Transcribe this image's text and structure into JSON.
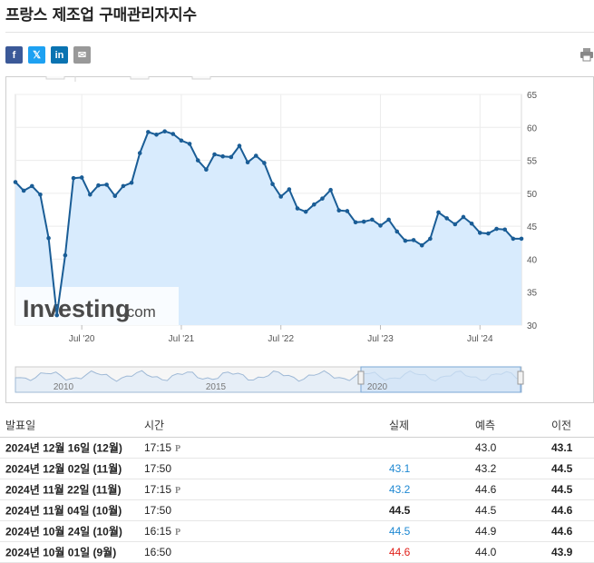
{
  "page": {
    "title": "프랑스 제조업 구매관리자지수"
  },
  "share": {
    "facebook_icon": "f",
    "twitter_icon": "𝕏",
    "linkedin_icon": "in",
    "email_icon": "✉"
  },
  "chart_data": {
    "type": "area",
    "title": "",
    "y_ticks": [
      "65",
      "60",
      "55",
      "50",
      "45",
      "40",
      "35",
      "30"
    ],
    "ylim": [
      30,
      65
    ],
    "x_tick_labels": [
      "Jul '20",
      "Jul '21",
      "Jul '22",
      "Jul '23",
      "Jul '24"
    ],
    "x_tick_dates": [
      "2020-07",
      "2021-07",
      "2022-07",
      "2023-07",
      "2024-07"
    ],
    "x_range": [
      "2019-11",
      "2024-12"
    ],
    "watermark": "Investing.com",
    "navigator_labels": [
      "2010",
      "2015",
      "2020"
    ],
    "series": [
      {
        "values": [
          [
            "2019-11",
            51.7
          ],
          [
            "2019-12",
            50.4
          ],
          [
            "2020-01",
            51.1
          ],
          [
            "2020-02",
            49.8
          ],
          [
            "2020-03",
            43.2
          ],
          [
            "2020-04",
            31.5
          ],
          [
            "2020-05",
            40.6
          ],
          [
            "2020-06",
            52.3
          ],
          [
            "2020-07",
            52.4
          ],
          [
            "2020-08",
            49.8
          ],
          [
            "2020-09",
            51.2
          ],
          [
            "2020-10",
            51.3
          ],
          [
            "2020-11",
            49.6
          ],
          [
            "2020-12",
            51.1
          ],
          [
            "2021-01",
            51.6
          ],
          [
            "2021-02",
            56.1
          ],
          [
            "2021-03",
            59.3
          ],
          [
            "2021-04",
            58.9
          ],
          [
            "2021-05",
            59.4
          ],
          [
            "2021-06",
            59.0
          ],
          [
            "2021-07",
            58.0
          ],
          [
            "2021-08",
            57.5
          ],
          [
            "2021-09",
            55.0
          ],
          [
            "2021-10",
            53.6
          ],
          [
            "2021-11",
            55.9
          ],
          [
            "2021-12",
            55.6
          ],
          [
            "2022-01",
            55.5
          ],
          [
            "2022-02",
            57.2
          ],
          [
            "2022-03",
            54.7
          ],
          [
            "2022-04",
            55.7
          ],
          [
            "2022-05",
            54.6
          ],
          [
            "2022-06",
            51.4
          ],
          [
            "2022-07",
            49.5
          ],
          [
            "2022-08",
            50.6
          ],
          [
            "2022-09",
            47.7
          ],
          [
            "2022-10",
            47.2
          ],
          [
            "2022-11",
            48.3
          ],
          [
            "2022-12",
            49.2
          ],
          [
            "2023-01",
            50.5
          ],
          [
            "2023-02",
            47.4
          ],
          [
            "2023-03",
            47.3
          ],
          [
            "2023-04",
            45.6
          ],
          [
            "2023-05",
            45.7
          ],
          [
            "2023-06",
            46.0
          ],
          [
            "2023-07",
            45.1
          ],
          [
            "2023-08",
            46.0
          ],
          [
            "2023-09",
            44.2
          ],
          [
            "2023-10",
            42.8
          ],
          [
            "2023-11",
            42.9
          ],
          [
            "2023-12",
            42.1
          ],
          [
            "2024-01",
            43.1
          ],
          [
            "2024-02",
            47.1
          ],
          [
            "2024-03",
            46.2
          ],
          [
            "2024-04",
            45.3
          ],
          [
            "2024-05",
            46.4
          ],
          [
            "2024-06",
            45.4
          ],
          [
            "2024-07",
            44.0
          ],
          [
            "2024-08",
            43.9
          ],
          [
            "2024-09",
            44.6
          ],
          [
            "2024-10",
            44.5
          ],
          [
            "2024-11",
            43.1
          ],
          [
            "2024-12",
            43.1
          ]
        ]
      }
    ],
    "colors": {
      "line": "#1a5d96",
      "fill": "#d8ebfd",
      "marker": "#1a5d96"
    }
  },
  "table": {
    "headers": {
      "date": "발표일",
      "time": "시간",
      "actual": "실제",
      "forecast": "예측",
      "previous": "이전"
    },
    "rows": [
      {
        "date": "2024년 12월 16일 (12월)",
        "time": "17:15",
        "prelim": "P",
        "actual": "",
        "actual_color": "black",
        "forecast": "43.0",
        "previous": "43.1"
      },
      {
        "date": "2024년 12월 02일 (11월)",
        "time": "17:50",
        "prelim": "",
        "actual": "43.1",
        "actual_color": "blue",
        "forecast": "43.2",
        "previous": "44.5"
      },
      {
        "date": "2024년 11월 22일 (11월)",
        "time": "17:15",
        "prelim": "P",
        "actual": "43.2",
        "actual_color": "blue",
        "forecast": "44.6",
        "previous": "44.5"
      },
      {
        "date": "2024년 11월 04일 (10월)",
        "time": "17:50",
        "prelim": "",
        "actual": "44.5",
        "actual_color": "black",
        "forecast": "44.5",
        "previous": "44.6"
      },
      {
        "date": "2024년 10월 24일 (10월)",
        "time": "16:15",
        "prelim": "P",
        "actual": "44.5",
        "actual_color": "blue",
        "forecast": "44.9",
        "previous": "44.6"
      },
      {
        "date": "2024년 10월 01일 (9월)",
        "time": "16:50",
        "prelim": "",
        "actual": "44.6",
        "actual_color": "red",
        "forecast": "44.0",
        "previous": "43.9"
      }
    ]
  }
}
